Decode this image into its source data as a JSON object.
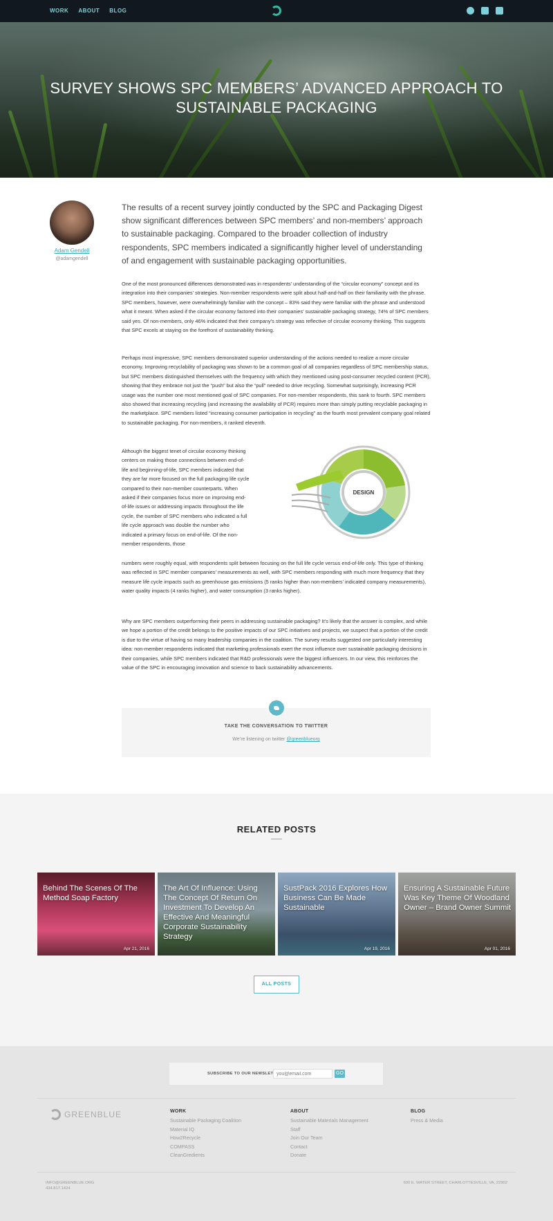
{
  "nav": {
    "links": [
      "WORK",
      "ABOUT",
      "BLOG"
    ],
    "social": [
      "circle-icon",
      "twitter-icon",
      "facebook-icon"
    ]
  },
  "hero": {
    "title": "SURVEY SHOWS SPC MEMBERS’ ADVANCED APPROACH TO SUSTAINABLE PACKAGING"
  },
  "author": {
    "name": "Adam Gendell",
    "handle": "@adamgendell"
  },
  "article": {
    "lead": "The results of a recent survey jointly conducted by the SPC and Packaging Digest show significant differences between SPC members’ and non-members’ approach to sustainable packaging. Compared to the broader collection of industry respondents, SPC members indicated a significantly higher level of understanding of and engagement with sustainable packaging opportunities.",
    "p1": "One of the most pronounced differences demonstrated was in respondents’ understanding of the “circular economy” concept and its integration into their companies’ strategies. Non-member respondents were split about half-and-half on their familiarity with the phrase. SPC members, however, were overwhelmingly familiar with the concept – 83% said they were familiar with the phrase and understood what it meant. When asked if the circular economy factored into their companies’ sustainable packaging strategy, 74% of SPC members said yes. Of non-members, only 46% indicated that their company’s strategy was reflective of circular economy thinking. This suggests that SPC excels at staying on the forefront of sustainability thinking.",
    "p2": "Perhaps most impressive, SPC members demonstrated superior understanding of the actions needed to realize a more circular economy. Improving recyclability of packaging was shown to be a common goal of all companies regardless of SPC membership status, but SPC members distinguished themselves with the frequency with which they mentioned using post-consumer recycled content (PCR), showing that they embrace not just the “push” but also the “pull” needed to drive recycling. Somewhat surprisingly, increasing PCR usage was the number one most mentioned goal of SPC companies. For non-member respondents, this sank to fourth. SPC members also showed that increasing recycling (and increasing the availability of PCR) requires more than simply putting recyclable packaging in the marketplace. SPC members listed “increasing consumer participation in recycling” as the fourth most prevalent company goal related to sustainable packaging. For non-members, it ranked eleventh.",
    "p3a": "Although the biggest tenet of circular economy thinking centers on making those connections between end-of-life and beginning-of-life, SPC members indicated that they are far more focused on the full packaging life cycle compared to their non-member counterparts. When asked if their companies focus more on improving end-of-life issues or addressing impacts throughout the life cycle, the number of SPC members who indicated a full life cycle approach was double the number who indicated a primary focus on end-of-life. Of the non-member respondents, those",
    "p3b": "numbers were roughly equal, with respondents split between focusing on the full life cycle versus end-of-life only. This type of thinking was reflected in SPC member companies’ measurements as well, with SPC members responding with much more frequency that they measure life cycle impacts such as greenhouse gas emissions (5 ranks higher than non-members’ indicated company measurements), water quality impacts (4 ranks higher), and water consumption (3 ranks higher).",
    "p4": "Why are SPC members outperforming their peers in addressing sustainable packaging? It’s likely that the answer is complex, and while we hope a portion of the credit belongs to the positive impacts of our SPC initiatives and projects, we suspect that a portion of the credit is due to the virtue of having so many leadership companies in the coalition. The survey results suggested one particularly interesting idea: non-member respondents indicated that marketing professionals exert the most influence over sustainable packaging decisions in their companies, while SPC members indicated that R&D professionals were the biggest influencers. In our view, this reinforces the value of the SPC in encouraging innovation and science to back sustainability advancements.",
    "diagram_center": "DESIGN"
  },
  "twitter": {
    "title": "TAKE THE CONVERSATION TO TWITTER",
    "sub_prefix": "We’re listening on twitter ",
    "handle": "@greenblueorg"
  },
  "related": {
    "title": "RELATED POSTS",
    "posts": [
      {
        "title": "Behind The Scenes Of The Method Soap Factory",
        "date": "Apr 21, 2016"
      },
      {
        "title": "The Art Of Influence: Using The Concept Of Return On Investment To Develop An Effective And Meaningful Corporate Sustainability Strategy",
        "date": ""
      },
      {
        "title": "SustPack 2016 Explores How Business Can Be Made Sustainable",
        "date": "Apr 19, 2016"
      },
      {
        "title": "Ensuring A Sustainable Future Was Key Theme Of Woodland Owner – Brand Owner Summit",
        "date": "Apr 01, 2016"
      }
    ],
    "all_posts": "ALL POSTS"
  },
  "footer": {
    "newsletter_label": "SUBSCRIBE TO OUR NEWSLETTER",
    "newsletter_placeholder": "you@email.com",
    "newsletter_button": "GO",
    "logo_text": "GREENBLUE",
    "work": {
      "title": "WORK",
      "items": [
        "Sustainable Packaging Coalition",
        "Material IQ",
        "How2Recycle",
        "COMPASS",
        "CleanGredients"
      ]
    },
    "about": {
      "title": "ABOUT",
      "items": [
        "Sustainable Materials Management",
        "Staff",
        "Join Our Team",
        "Contact",
        "Donate"
      ]
    },
    "blog": {
      "title": "BLOG",
      "items": [
        "Press & Media"
      ]
    },
    "email": "INFO@GREENBLUE.ORG",
    "phone": "434.817.1424",
    "address": "600 E. WATER STREET, CHARLOTTESVILLE, VA, 22902"
  }
}
